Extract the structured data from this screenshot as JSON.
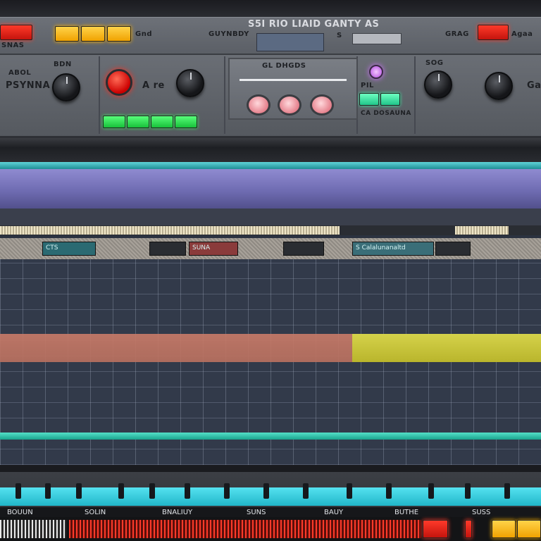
{
  "top_panel": {
    "title": "S5I RIO LIAID GANTY AS",
    "left_label": "SNAS",
    "left_sub": "Gnd",
    "sub_label_1": "GUYNBDY",
    "sub_label_2": "S",
    "right_label_1": "GRAG",
    "right_label_2": "Agaa",
    "center_title": "GL DHGDS",
    "center_sub": "CA DOSAUNA",
    "mode_label": "A re"
  },
  "rack": {
    "brand_label": "PSYNNA",
    "knob1_label": "ABOL",
    "knob2_label": "BDN",
    "right_badge": "Gas",
    "led_label_1": "PIL",
    "led_label_2": "SOG"
  },
  "timeline": {
    "clips": [
      "CTS",
      "SUNA",
      "S Calalunanaltd"
    ]
  },
  "bottom": {
    "labels": [
      "BOUUN",
      "SOLIN",
      "BNALIUY",
      "SUNS",
      "BAUY",
      "BUTHE",
      "SUSS"
    ]
  },
  "colors": {
    "led_red": "#ff3a2a",
    "led_amber": "#ffb400",
    "led_green": "#39f060",
    "timeline_cyan": "#5fd3d8",
    "timeline_purple": "#8f8bd0",
    "lane_orange": "#c77a68",
    "lane_yellow": "#d5d24a"
  }
}
